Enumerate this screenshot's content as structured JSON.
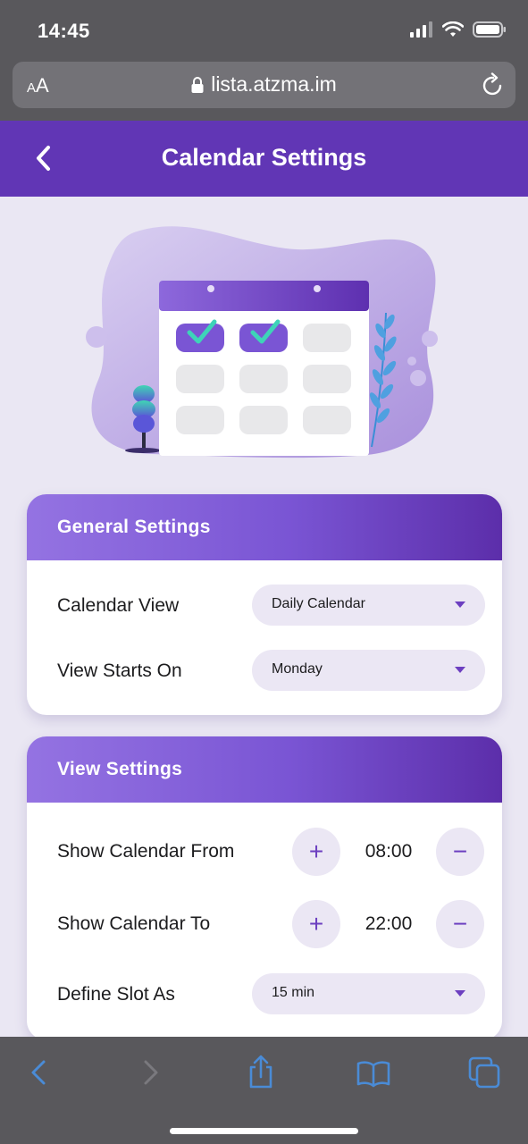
{
  "status": {
    "time": "14:45"
  },
  "browser": {
    "text_size_label_small": "A",
    "text_size_label_large": "A",
    "url": "lista.atzma.im"
  },
  "header": {
    "title": "Calendar Settings"
  },
  "general": {
    "title": "General Settings",
    "calendar_view": {
      "label": "Calendar View",
      "value": "Daily Calendar"
    },
    "view_starts_on": {
      "label": "View Starts On",
      "value": "Monday"
    }
  },
  "view": {
    "title": "View Settings",
    "show_from": {
      "label": "Show Calendar From",
      "value": "08:00",
      "plus": "+",
      "minus": "−"
    },
    "show_to": {
      "label": "Show Calendar To",
      "value": "22:00",
      "plus": "+",
      "minus": "−"
    },
    "slot": {
      "label": "Define Slot As",
      "value": "15 min"
    }
  },
  "colors": {
    "primary": "#6136b5",
    "accent": "#6c3fc0",
    "teal": "#3ed3b8",
    "safari_blue": "#4a8bd6"
  },
  "icons": [
    "signal-icon",
    "wifi-icon",
    "battery-icon",
    "lock-icon",
    "reload-icon",
    "back-chevron-icon",
    "share-icon",
    "bookmarks-icon",
    "tabs-icon"
  ]
}
